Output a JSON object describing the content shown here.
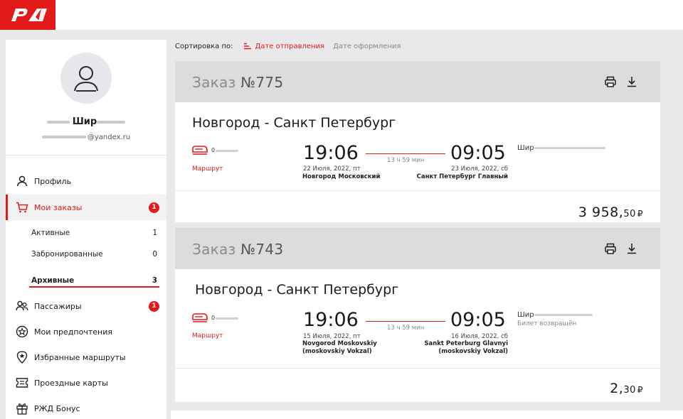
{
  "colors": {
    "accent": "#e21a1a",
    "header_bg": "#dcdcdd",
    "page_bg": "#e9e9eb"
  },
  "logo": {
    "icon": "rzd-logo-icon"
  },
  "user": {
    "name": "Шир",
    "email_domain": "@yandex.ru"
  },
  "nav": {
    "profile": "Профиль",
    "orders": "Мои заказы",
    "orders_badge": "1",
    "passengers": "Пассажиры",
    "passengers_badge": "1",
    "preferences": "Мои предпочтения",
    "favorite_routes": "Избранные маршруты",
    "travel_cards": "Проездные карты",
    "bonus": "РЖД Бонус"
  },
  "orders_sub": [
    {
      "label": "Активные",
      "count": "1"
    },
    {
      "label": "Забронированные",
      "count": "0"
    },
    {
      "label": "Архивные",
      "count": "3"
    }
  ],
  "sort": {
    "label": "Сортировка по:",
    "active": "Дате отправления",
    "other": "Дате оформления"
  },
  "orders": [
    {
      "title": "Заказ ",
      "number": "№775",
      "route": "Новгород - Санкт Петербург",
      "train_count": "0",
      "route_link": "Маршрут",
      "dep_time": "19:06",
      "arr_time": "09:05",
      "duration": "13 ч 59 мин",
      "dep_date": "22 Июля, 2022, пт",
      "arr_date": "23 Июля, 2022, сб",
      "dep_station": "Новгород Московский",
      "arr_station": "Санкт Петербург Главный",
      "passenger": "Шир",
      "ticket_status": "",
      "price_main": "3 958,",
      "price_kop": "50",
      "currency": "₽"
    },
    {
      "title": "Заказ ",
      "number": "№743",
      "route": "Новгород - Санкт Петербург",
      "train_count": "0",
      "route_link": "Маршрут",
      "dep_time": "19:06",
      "arr_time": "09:05",
      "duration": "13 ч 59 мин",
      "dep_date": "15 Июля, 2022, пт",
      "arr_date": "16 Июля, 2022, сб",
      "dep_station_1": "Novgorod Moskovskiy",
      "dep_station_2": "(moskovskiy Vokzal)",
      "arr_station_1": "Sankt Peterburg Glavnyi",
      "arr_station_2": "(moskovskiy Vokzal)",
      "passenger": "Шир",
      "ticket_status": "Билет возвращён",
      "price_main": "2,",
      "price_kop": "30",
      "currency": "₽"
    }
  ],
  "icons": {
    "print": "print-icon",
    "download": "download-icon",
    "train": "train-icon"
  }
}
